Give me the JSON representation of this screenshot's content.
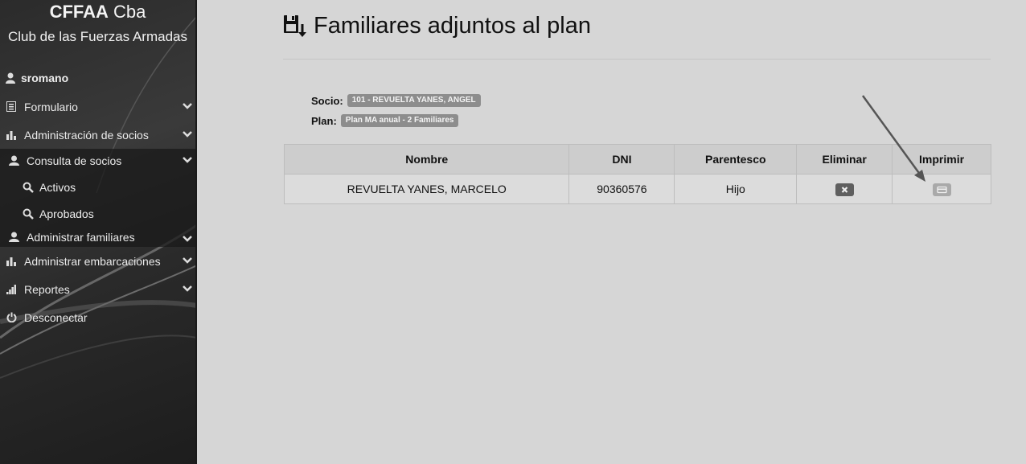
{
  "brand": {
    "title_bold": "CFFAA",
    "title_rest": " Cba",
    "subtitle": "Club de las Fuerzas Armadas"
  },
  "user": {
    "name": "sromano",
    "icon": "user-icon"
  },
  "nav": {
    "formulario": "Formulario",
    "admin_socios": "Administración de socios",
    "consulta_socios": "Consulta de socios",
    "activos": "Activos",
    "aprobados": "Aprobados",
    "admin_familiares": "Administrar familiares",
    "admin_embarcaciones": "Administrar embarcaciones",
    "reportes": "Reportes",
    "desconectar": "Desconectar"
  },
  "page": {
    "title": "Familiares adjuntos al plan",
    "title_icon": "save-download-icon"
  },
  "info": {
    "socio_label": "Socio:",
    "socio_value": "101 - REVUELTA YANES, ANGEL",
    "plan_label": "Plan:",
    "plan_value": "Plan MA anual - 2 Familiares"
  },
  "table": {
    "headers": {
      "nombre": "Nombre",
      "dni": "DNI",
      "parentesco": "Parentesco",
      "eliminar": "Eliminar",
      "imprimir": "Imprimir"
    },
    "rows": [
      {
        "nombre": "REVUELTA YANES, MARCELO",
        "dni": "90360576",
        "parentesco": "Hijo"
      }
    ]
  }
}
